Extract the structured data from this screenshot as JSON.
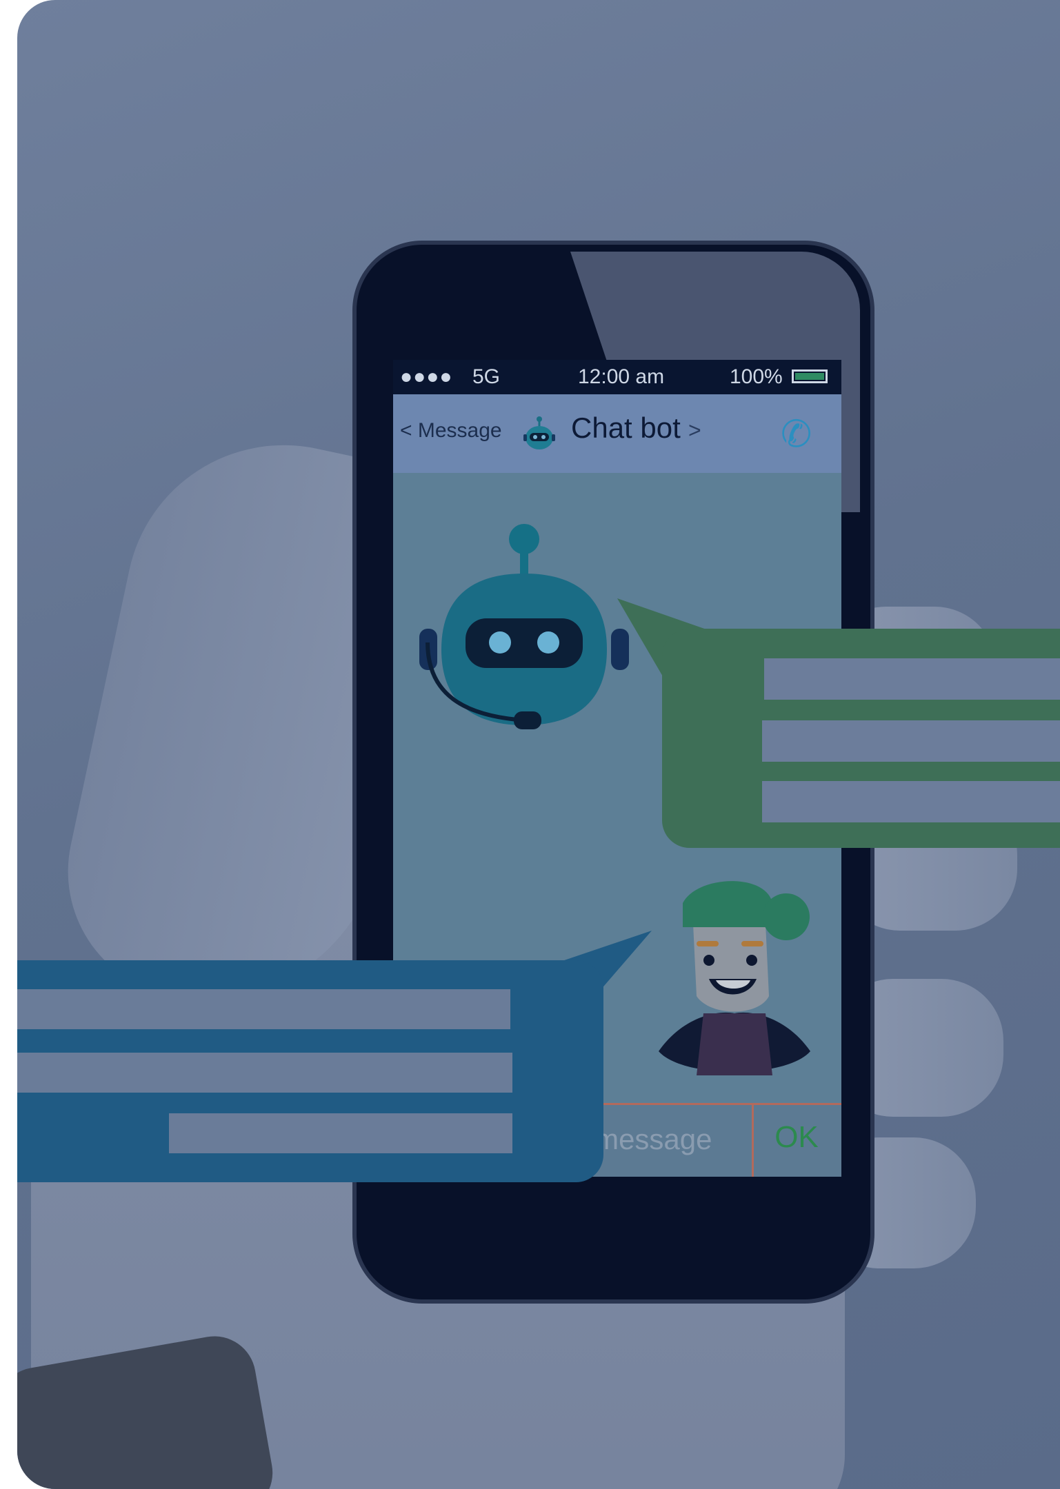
{
  "status_bar": {
    "signal_dots": "●●●●",
    "network": "5G",
    "time": "12:00 am",
    "battery_percent": "100%",
    "battery_level": 1.0
  },
  "nav_bar": {
    "back_label": "< Message",
    "title": "Chat bot",
    "title_chevron": ">",
    "call_icon": "phone-icon"
  },
  "input_bar": {
    "placeholder": "Enter a message",
    "ok_label": "OK"
  },
  "colors": {
    "overlay_tint": "#61728f",
    "bot_bubble": "#3e6f57",
    "user_bubble": "#205b84",
    "phone_body": "#081129",
    "nav_bar": "#6d87b0",
    "ok_text": "#2c8a4e",
    "call_icon": "#2b8fc0"
  }
}
